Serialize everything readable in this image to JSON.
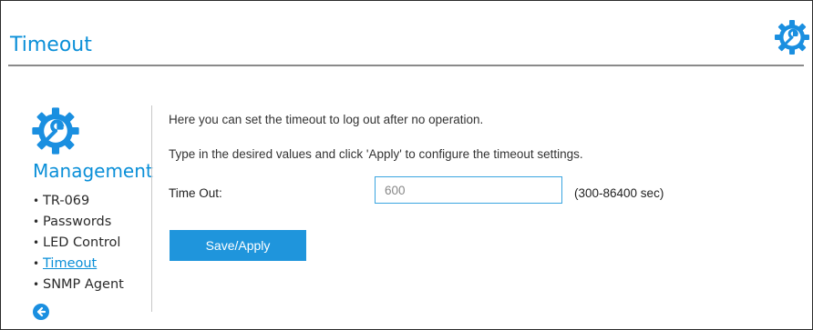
{
  "header": {
    "title": "Timeout",
    "icon": "gear-wrench-icon"
  },
  "sidebar": {
    "icon": "gear-wrench-icon",
    "title": "Management",
    "items": [
      {
        "label": "TR-069",
        "active": false
      },
      {
        "label": "Passwords",
        "active": false
      },
      {
        "label": "LED Control",
        "active": false
      },
      {
        "label": "Timeout",
        "active": true
      },
      {
        "label": "SNMP Agent",
        "active": false
      }
    ],
    "back_icon": "arrow-left-circle-icon"
  },
  "main": {
    "intro": "Here you can set the timeout to log out after no operation.",
    "instructions": "Type in the desired values and click 'Apply' to configure the timeout settings.",
    "timeout_field": {
      "label": "Time Out:",
      "value": "600",
      "hint": "(300-86400 sec)"
    },
    "save_label": "Save/Apply"
  },
  "colors": {
    "accent": "#0a8fd8",
    "button": "#1f95dc",
    "rule": "#8a8a8a"
  }
}
